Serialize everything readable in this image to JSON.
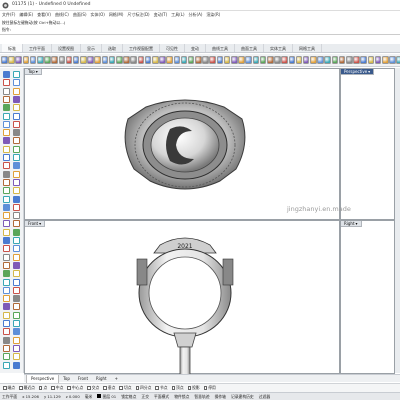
{
  "window": {
    "title": "01175 (1) - Undefined 0 Undefined"
  },
  "menubar": {
    "items": [
      "文件(F)",
      "编辑(E)",
      "查看(V)",
      "曲线(C)",
      "曲面(S)",
      "实体(O)",
      "网格(M)",
      "尺寸标注(D)",
      "变动(T)",
      "工具(L)",
      "分析(A)",
      "渲染(R)"
    ]
  },
  "command": {
    "history_line": "按住鼠标左键拖动(按 Ctrl+拖动以...)",
    "prompt": "指令:"
  },
  "tabs": {
    "items": [
      "标准",
      "工作平面",
      "设置视图",
      "显示",
      "选取",
      "工作视窗配置",
      "可见性",
      "变动",
      "曲线工具",
      "曲面工具",
      "实体工具",
      "网格工具"
    ],
    "active_index": 0
  },
  "viewports": {
    "top": {
      "label": "Top"
    },
    "perspective": {
      "label": "Perspective"
    },
    "front": {
      "label": "Front"
    },
    "right": {
      "label": "Right"
    },
    "watermark": "jingzhanyi.en.made"
  },
  "viewport_tabs": {
    "items": [
      "Perspective",
      "Top",
      "Front",
      "Right"
    ],
    "add_label": "+"
  },
  "osnap": {
    "items": [
      "端点",
      "最近点",
      "点",
      "中点",
      "中心点",
      "交点",
      "垂点",
      "切点",
      "四分点",
      "节点",
      "顶点",
      "投影",
      "停用"
    ]
  },
  "status": {
    "plane": "工作平面",
    "x": "x 15.206",
    "y": "y 11.129",
    "z": "z 0.000",
    "unit": "毫米",
    "layer": "图层 01",
    "grid_snap": "锁定格点",
    "ortho": "正交",
    "planar": "平面模式",
    "osnap": "物件锁点",
    "smarttrack": "智慧轨迹",
    "gumball": "操作轴",
    "history": "记录建构历史",
    "filter": "过滤器"
  },
  "colors": {
    "active_viewport_label": "#3a5a8c",
    "viewport_border": "#9aa0a6",
    "toolbar_bg": "#f1f3f5"
  }
}
